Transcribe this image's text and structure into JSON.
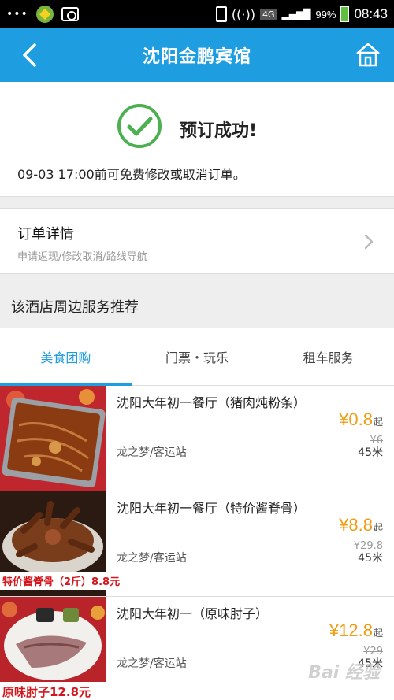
{
  "status_bar": {
    "dots": "•••",
    "network": "4G",
    "battery_pct": "99%",
    "time": "08:43"
  },
  "header": {
    "title": "沈阳金鹏宾馆",
    "back_icon": "back-arrow-icon",
    "home_icon": "home-icon"
  },
  "success": {
    "icon": "check-circle-icon",
    "message": "预订成功!",
    "note": "09-03 17:00前可免费修改或取消订单。"
  },
  "order": {
    "title": "订单详情",
    "subtitle": "申请返现/修改取消/路线导航"
  },
  "section_title": "该酒店周边服务推荐",
  "tabs": [
    "美食团购",
    "门票・玩乐",
    "租车服务"
  ],
  "items": [
    {
      "name": "沈阳大年初一餐厅（猪肉炖粉条）",
      "price": "¥0.8",
      "unit": "起",
      "old_price": "¥6",
      "location": "龙之梦/客运站",
      "distance": "45米",
      "caption": ""
    },
    {
      "name": "沈阳大年初一餐厅（特价酱脊骨）",
      "price": "¥8.8",
      "unit": "起",
      "old_price": "¥29.8",
      "location": "龙之梦/客运站",
      "distance": "45米",
      "caption": "特价酱脊骨（2斤）8.8元"
    },
    {
      "name": "沈阳大年初一（原味肘子）",
      "price": "¥12.8",
      "unit": "起",
      "old_price": "¥29",
      "location": "龙之梦/客运站",
      "distance": "45米",
      "caption": "原味肘子12.8元"
    }
  ],
  "watermark": "Bai 经验",
  "colors": {
    "accent": "#1e9de0",
    "price": "#f39c12",
    "success": "#4caf50"
  }
}
